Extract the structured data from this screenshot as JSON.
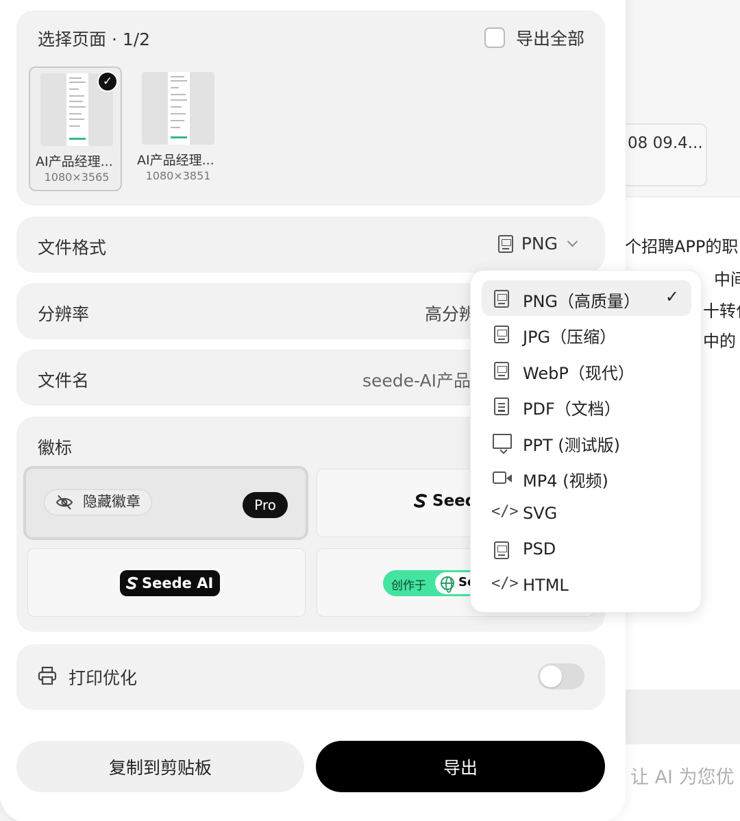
{
  "background": {
    "date_chip": "08 09.4...",
    "text_lines": [
      "个招聘APP的职",
      "中间",
      "十转化",
      "中的"
    ],
    "input_placeholder": "让 AI 为您优"
  },
  "page_select": {
    "title": "选择页面 · 1/2",
    "export_all_label": "导出全部",
    "pages": [
      {
        "name": "AI产品经理...",
        "size": "1080×3565",
        "selected": true
      },
      {
        "name": "AI产品经理...",
        "size": "1080×3851",
        "selected": false
      }
    ]
  },
  "file_format": {
    "label": "文件格式",
    "value": "PNG"
  },
  "resolution": {
    "label": "分辨率",
    "value": "高分辨"
  },
  "filename": {
    "label": "文件名",
    "value": "seede-AI产品"
  },
  "logo": {
    "label": "徽标",
    "hide_label": "隐藏徽章",
    "pro": "Pro",
    "seed_label": "Seed",
    "seede_ai_label": "Seede AI",
    "created_label": "创作于",
    "created_suffix": "Se"
  },
  "print": {
    "label": "打印优化",
    "enabled": false
  },
  "buttons": {
    "copy": "复制到剪贴板",
    "export": "导出"
  },
  "format_options": [
    {
      "label": "PNG（高质量）",
      "icon": "png-file-icon",
      "selected": true
    },
    {
      "label": "JPG（压缩）",
      "icon": "jpg-file-icon",
      "selected": false
    },
    {
      "label": "WebP（现代）",
      "icon": "webp-file-icon",
      "selected": false
    },
    {
      "label": "PDF（文档）",
      "icon": "pdf-file-icon",
      "selected": false
    },
    {
      "label": "PPT (测试版)",
      "icon": "presentation-icon",
      "selected": false
    },
    {
      "label": "MP4 (视频)",
      "icon": "video-icon",
      "selected": false
    },
    {
      "label": "SVG",
      "icon": "code-icon",
      "selected": false
    },
    {
      "label": "PSD",
      "icon": "psd-file-icon",
      "selected": false
    },
    {
      "label": "HTML",
      "icon": "code-icon",
      "selected": false
    }
  ],
  "check_mark": "✓",
  "colors": {
    "accent": "#000000",
    "created_badge": "#44e3a0"
  }
}
